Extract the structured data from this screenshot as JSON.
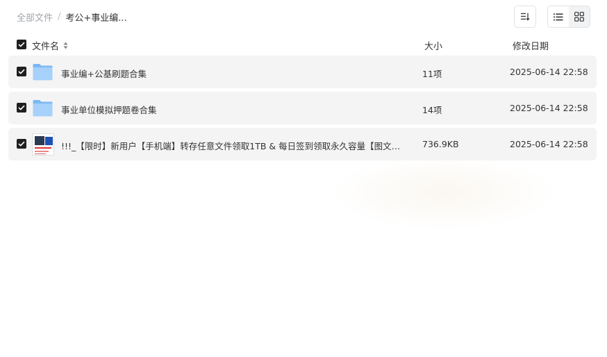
{
  "breadcrumb": {
    "root": "全部文件",
    "separator": "/",
    "current": "考公+事业编..."
  },
  "toolbar": {
    "sort_icon": "sort-list-icon",
    "view_list_icon": "list-view-icon",
    "view_grid_icon": "grid-view-icon",
    "active_view": "list"
  },
  "table": {
    "headers": {
      "name": "文件名",
      "size": "大小",
      "date": "修改日期"
    },
    "rows": [
      {
        "name": "事业编+公基刷题合集",
        "size": "11项",
        "date": "2025-06-14 22:58",
        "type": "folder",
        "checked": true
      },
      {
        "name": "事业单位模拟押题卷合集",
        "size": "14项",
        "date": "2025-06-14 22:58",
        "type": "folder",
        "checked": true
      },
      {
        "name": "!!!_【限时】新用户【手机端】转存任意文件领取1TB & 每日签到领取永久容量【图文指...",
        "size": "736.9KB",
        "date": "2025-06-14 22:58",
        "type": "image",
        "checked": true
      }
    ]
  },
  "colors": {
    "row_bg": "#f4f4f5",
    "checkbox": "#1f1f1f",
    "folder_light": "#a6d1fa",
    "folder_dark": "#7bb8f3"
  }
}
